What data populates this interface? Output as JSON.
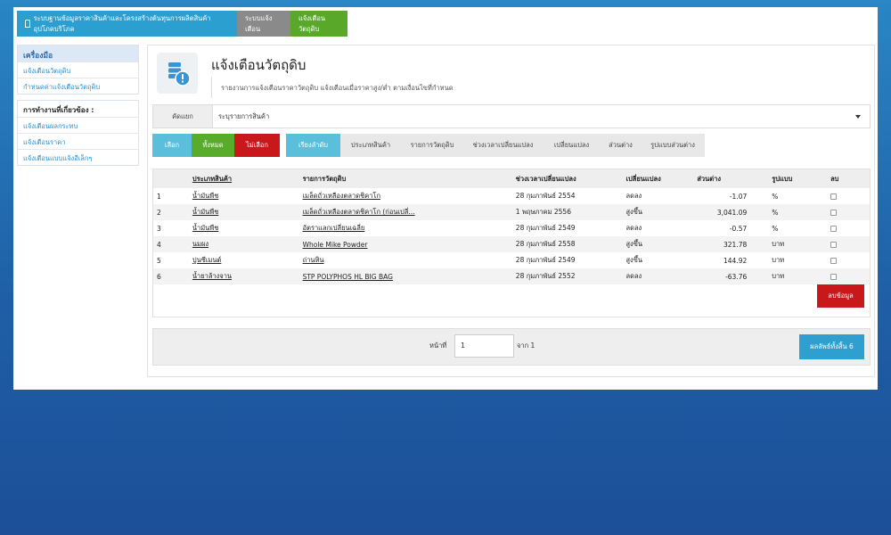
{
  "topnav": {
    "main_label": "ระบบฐานข้อมูลราคาสินค้าและโครงสร้างต้นทุนการผลิตสินค้าอุปโภคบริโภค",
    "alert_label": "ระบบแจ้งเตือน",
    "material_label": "แจ้งเตือนวัตถุดิบ"
  },
  "sidebar": {
    "tools_title": "เครื่องมือ",
    "tools_items": [
      "แจ้งเตือนวัตถุดิบ",
      "กำหนดค่าแจ้งเตือนวัตถุดิบ"
    ],
    "related_title": "การทำงานที่เกี่ยวข้อง :",
    "related_items": [
      "แจ้งเตือนผลกระทบ",
      "แจ้งเตือนราคา",
      "แจ้งเตือนแบบแจ้งอีเล็กๆ"
    ]
  },
  "header": {
    "title": "แจ้งเตือนวัตถุดิบ",
    "description": "รายงานการแจ้งเตือนราคาวัตถุดิบ แจ้งเตือนเมื่อราคาสูง/ต่ำ ตามเงื่อนไขที่กำหนด"
  },
  "filter": {
    "label": "คัดแยก",
    "value": "ระบุรายการสินค้า"
  },
  "toolbar": {
    "select": "เลือก",
    "all": "ทั้งหมด",
    "none": "ไม่เลือก",
    "sort_label": "เรียงลำดับ",
    "sort_options": [
      "ประเภทสินค้า",
      "รายการวัตถุดิบ",
      "ช่วงเวลาเปลี่ยนแปลง",
      "เปลี่ยนแปลง",
      "ส่วนต่าง",
      "รูปแบบส่วนต่าง"
    ]
  },
  "table": {
    "headers": {
      "category": "ประเภทสินค้า",
      "material": "รายการวัตถุดิบ",
      "period": "ช่วงเวลาเปลี่ยนแปลง",
      "change": "เปลี่ยนแปลง",
      "diff": "ส่วนต่าง",
      "format": "รูปแบบ",
      "delete": "ลบ"
    },
    "rows": [
      {
        "no": "1",
        "category": "น้ำมันพืช",
        "material": "เมล็ดถั่วเหลืองตลาดชิคาโก",
        "period": "28 กุมภาพันธ์ 2554",
        "change": "ลดลง",
        "diff": "-1.07",
        "format": "%"
      },
      {
        "no": "2",
        "category": "น้ำมันพืช",
        "material": "เมล็ดถั่วเหลืองตลาดชิคาโก (ก่อนเปลี่...",
        "period": "1 พฤษภาคม 2556",
        "change": "สูงขึ้น",
        "diff": "3,041.09",
        "format": "%"
      },
      {
        "no": "3",
        "category": "น้ำมันพืช",
        "material": "อัตราแลกเปลี่ยนเฉลี่ย",
        "period": "28 กุมภาพันธ์ 2549",
        "change": "ลดลง",
        "diff": "-0.57",
        "format": "%"
      },
      {
        "no": "4",
        "category": "นมผง",
        "material": "Whole Mike Powder",
        "period": "28 กุมภาพันธ์ 2558",
        "change": "สูงขึ้น",
        "diff": "321.78",
        "format": "บาท"
      },
      {
        "no": "5",
        "category": "ปูนซีเมนต์",
        "material": "ถ่านหิน",
        "period": "28 กุมภาพันธ์ 2549",
        "change": "สูงขึ้น",
        "diff": "144.92",
        "format": "บาท"
      },
      {
        "no": "6",
        "category": "น้ำยาล้างจาน",
        "material": "STP POLYPHOS HL BIG BAG",
        "period": "28 กุมภาพันธ์ 2552",
        "change": "ลดลง",
        "diff": "-63.76",
        "format": "บาท"
      }
    ],
    "delete_button": "ลบข้อมูล"
  },
  "pager": {
    "page_label": "หน้าที่",
    "page_value": "1",
    "of_label": "จาก 1",
    "result_label": "ผลลัพธ์ทั้งสิ้น 6"
  },
  "colors": {
    "blue_tab": "#2a9fd0",
    "grey_tab": "#8a8a8a",
    "green": "#58ab2b",
    "red": "#c8181c",
    "teal": "#5bbfdb"
  }
}
